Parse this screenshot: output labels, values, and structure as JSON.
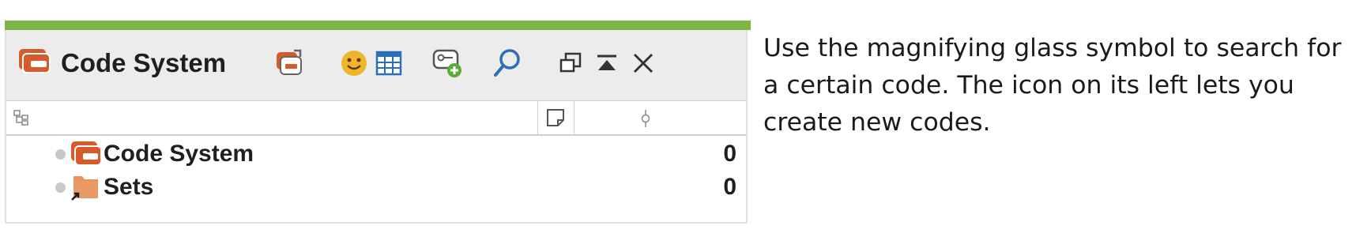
{
  "panel": {
    "title": "Code System",
    "toolbar": {
      "icons": [
        "new-code-icon",
        "smiley-icon",
        "table-icon",
        "new-code-link-icon",
        "search-icon",
        "undock-icon",
        "collapse-icon",
        "close-icon"
      ]
    },
    "columns": [
      "tree-icon",
      "memo-icon",
      "frequency-icon"
    ],
    "rows": [
      {
        "label": "Code System",
        "count": "0",
        "icon": "code-system-icon"
      },
      {
        "label": "Sets",
        "count": "0",
        "icon": "folder-shortcut-icon"
      }
    ],
    "colors": {
      "accent": "#7ab648",
      "code_icon": "#d75a2b",
      "folder": "#e8935a",
      "smiley": "#f2b52a",
      "table": "#2a6fb8"
    }
  },
  "caption": {
    "text": "Use the magnifying glass symbol to search for a certain code. The icon on its left lets you create new codes."
  }
}
